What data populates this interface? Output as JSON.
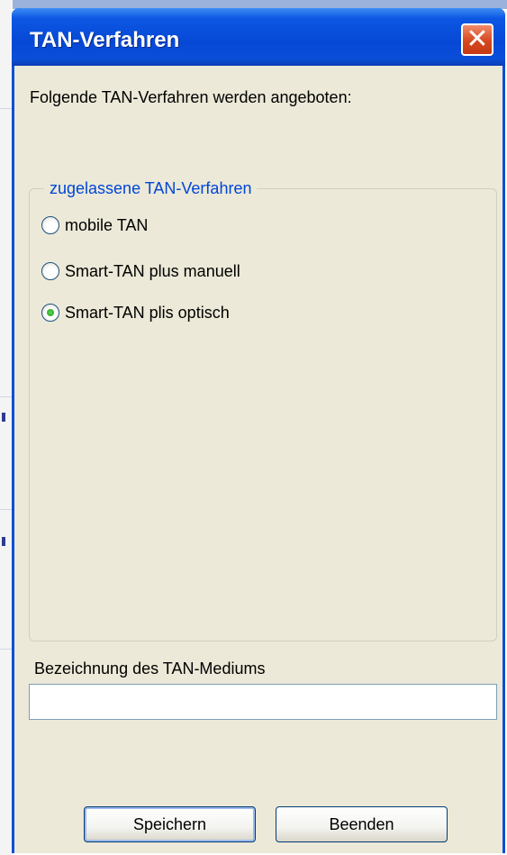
{
  "dialog": {
    "title": "TAN-Verfahren",
    "close_symbol": "✕",
    "intro": "Folgende TAN-Verfahren werden angeboten:"
  },
  "group": {
    "legend": "zugelassene TAN-Verfahren",
    "options": [
      {
        "label": "mobile TAN",
        "checked": false
      },
      {
        "label": "Smart-TAN plus manuell",
        "checked": false
      },
      {
        "label": "Smart-TAN plis optisch",
        "checked": true
      }
    ]
  },
  "medium": {
    "label": "Bezeichnung des TAN-Mediums",
    "value": ""
  },
  "buttons": {
    "save": "Speichern",
    "close": "Beenden"
  },
  "colors": {
    "titlebar": "#0648d6",
    "client": "#ece9d8",
    "legend_text": "#0046d5",
    "close_button": "#d6471f"
  },
  "icons": {
    "close": "close-icon"
  }
}
